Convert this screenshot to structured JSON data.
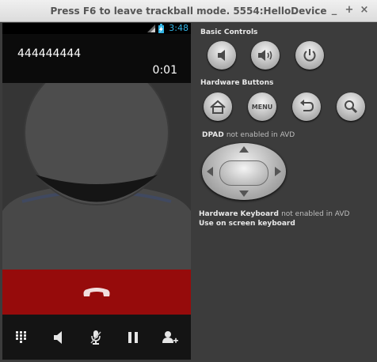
{
  "window": {
    "title": "Press F6 to leave trackball mode. 5554:HelloDevice",
    "minimize": "_",
    "maximize": "+",
    "close": "×"
  },
  "phone": {
    "status_time": "3:48",
    "number": "444444444",
    "timer": "0:01"
  },
  "controls": {
    "basic_label": "Basic Controls",
    "hardware_label": "Hardware Buttons",
    "menu_label": "MENU",
    "dpad_prefix": "DPAD",
    "dpad_suffix": "not enabled in AVD",
    "keyboard_prefix": "Hardware Keyboard",
    "keyboard_suffix": "not enabled in AVD",
    "onscreen": "Use on screen keyboard"
  },
  "colors": {
    "end_call": "#960b0b",
    "status_accent": "#33b5e5"
  }
}
